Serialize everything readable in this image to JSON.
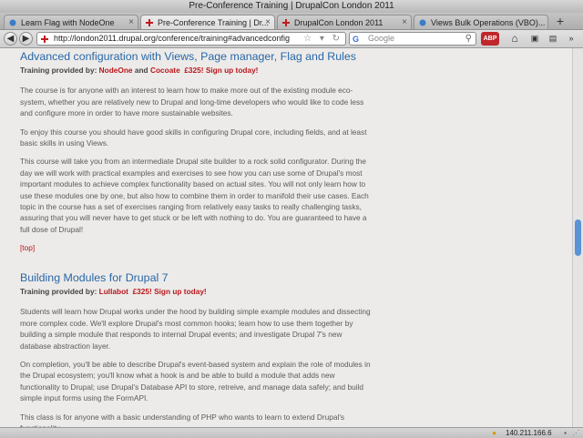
{
  "window": {
    "title": "Pre-Conference Training | DrupalCon London 2011"
  },
  "tabs": [
    {
      "label": "Learn Flag with NodeOne",
      "active": false
    },
    {
      "label": "Pre-Conference Training | Dr...",
      "active": true
    },
    {
      "label": "DrupalCon London 2011",
      "active": false
    },
    {
      "label": "Views Bulk Operations (VBO)...",
      "active": false
    }
  ],
  "newtab_label": "+",
  "nav": {
    "back": "◀",
    "forward": "▶",
    "url": "http://london2011.drupal.org/conference/training#advancedconfig",
    "url_icons": "☆ ▾ ↻",
    "search_engine": "G",
    "search_placeholder": "Google",
    "search_icon": "⚲",
    "addon_label": "ABP",
    "home_icon": "⌂"
  },
  "sections": {
    "advanced": {
      "title": "Advanced configuration with Views, Page manager, Flag and Rules",
      "provided_by": "Training provided by:",
      "provider1": "NodeOne",
      "and": "and",
      "provider2": "Cocoate",
      "price": "£325! Sign up today!",
      "p1": "The course is for anyone with an interest to learn how to make more out of the existing module eco-system, whether you are relatively new to Drupal and long-time developers who would like to code less and configure more in order to have more sustainable websites.",
      "p2": "To enjoy this course you should have good skills in configuring Drupal core, including fields, and at least basic skills in using Views.",
      "p3": "This course will take you from an intermediate Drupal site builder to a rock solid configurator. During the day we will work with practical examples and exercises to see how you can use some of Drupal's most important modules to achieve complex functionality based on actual sites. You will not only learn how to use these modules one by one, but also how to combine them in order to manifold their use cases. Each topic in the course has a set of exercises ranging from relatively easy tasks to really challenging tasks, assuring that you will never have to get stuck or be left with nothing to do. You are guaranteed to have a full dose of Drupal!",
      "top_link": "[top]"
    },
    "modules": {
      "title": "Building Modules for Drupal 7",
      "provided_by": "Training provided by:",
      "provider1": "Lullabot",
      "price": "£325! Sign up today!",
      "p1": "Students will learn how Drupal works under the hood by building simple example modules and dissecting more complex code. We'll explore Drupal's most common hooks; learn how to use them together by building a simple module that responds to internal Drupal events; and investigate Drupal 7's new database abstraction layer.",
      "p2": "On completion, you'll be able to describe Drupal's event-based system and explain the role of modules in the Drupal ecosystem; you'll know what a hook is and be able to build a module that adds new functionality to Drupal; use Drupal's Database API to store, retreive, and manage data safely; and build simple input forms using the FormAPI.",
      "p3": "This class is for anyone with a basic understanding of PHP who wants to learn to extend Drupal's functionality."
    }
  },
  "status": {
    "ip": "140.211.166.6"
  },
  "colors": {
    "link_blue": "#2a67a8",
    "accent_red": "#b8171d",
    "scroll_thumb": "#5a93d6"
  }
}
